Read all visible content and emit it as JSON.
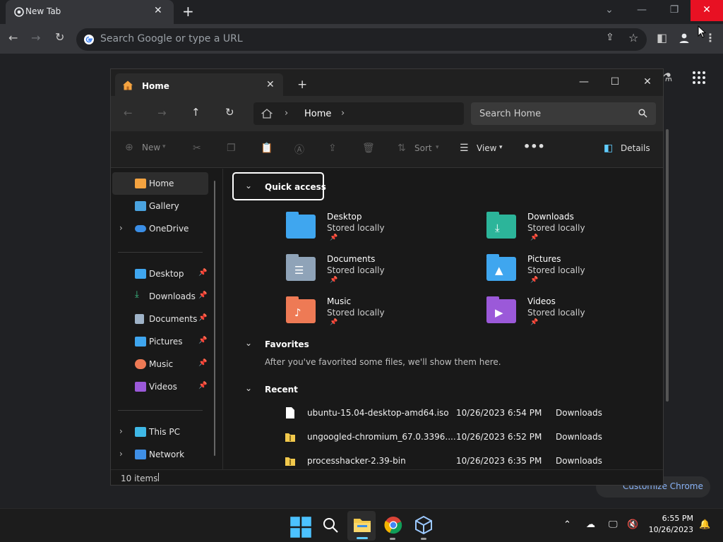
{
  "chrome": {
    "tab_title": "New Tab",
    "tab_close": "✕",
    "new_tab": "+",
    "omnibox_placeholder": "Search Google or type a URL",
    "customize_label": "Customize Chrome",
    "window_controls": {
      "dropdown": "⌄",
      "minimize": "—",
      "restore": "❐",
      "close": "✕"
    }
  },
  "explorer": {
    "tab_title": "Home",
    "tab_close": "✕",
    "new_tab": "+",
    "window_controls": {
      "minimize": "—",
      "maximize": "☐",
      "close": "✕"
    },
    "address": {
      "location": "Home",
      "sep1": "›",
      "sep2": "›"
    },
    "search_placeholder": "Search Home",
    "command_bar": {
      "new": "New",
      "sort": "Sort",
      "view": "View",
      "more": "•••",
      "details": "Details"
    },
    "sidebar": {
      "items": [
        {
          "label": "Home"
        },
        {
          "label": "Gallery"
        },
        {
          "label": "OneDrive"
        },
        {
          "label": "Desktop"
        },
        {
          "label": "Downloads"
        },
        {
          "label": "Documents"
        },
        {
          "label": "Pictures"
        },
        {
          "label": "Music"
        },
        {
          "label": "Videos"
        },
        {
          "label": "This PC"
        },
        {
          "label": "Network"
        }
      ]
    },
    "groups": {
      "quick_access": "Quick access",
      "favorites": "Favorites",
      "favorites_empty": "After you've favorited some files, we'll show them here.",
      "recent": "Recent"
    },
    "quick_access": [
      {
        "name": "Desktop",
        "sub": "Stored locally"
      },
      {
        "name": "Downloads",
        "sub": "Stored locally"
      },
      {
        "name": "Documents",
        "sub": "Stored locally"
      },
      {
        "name": "Pictures",
        "sub": "Stored locally"
      },
      {
        "name": "Music",
        "sub": "Stored locally"
      },
      {
        "name": "Videos",
        "sub": "Stored locally"
      }
    ],
    "recent": [
      {
        "name": "ubuntu-15.04-desktop-amd64.iso",
        "date": "10/26/2023 6:54 PM",
        "location": "Downloads"
      },
      {
        "name": "ungoogled-chromium_67.0.3396....",
        "date": "10/26/2023 6:52 PM",
        "location": "Downloads"
      },
      {
        "name": "processhacker-2.39-bin",
        "date": "10/26/2023 6:35 PM",
        "location": "Downloads"
      }
    ],
    "status": "10 items"
  },
  "taskbar": {
    "time": "6:55 PM",
    "date": "10/26/2023"
  },
  "colors": {
    "close_red": "#e81123",
    "accent": "#60cdff"
  }
}
